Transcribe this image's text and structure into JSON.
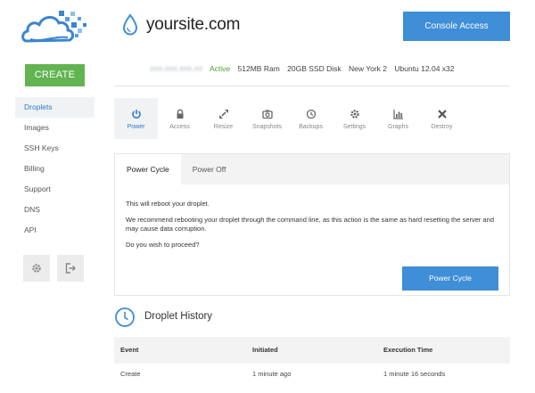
{
  "sidebar": {
    "create_label": "CREATE",
    "items": [
      {
        "label": "Droplets",
        "active": true
      },
      {
        "label": "Images"
      },
      {
        "label": "SSH Keys"
      },
      {
        "label": "Billing"
      },
      {
        "label": "Support"
      },
      {
        "label": "DNS"
      },
      {
        "label": "API"
      }
    ],
    "bottom_icons": [
      "gear-icon",
      "logout-icon"
    ]
  },
  "header": {
    "title": "yoursite.com",
    "console_button": "Console Access"
  },
  "info": {
    "ip_blurred": "###.###.###.##",
    "status": "Active",
    "ram": "512MB Ram",
    "disk": "20GB SSD Disk",
    "region": "New York 2",
    "os": "Ubuntu 12.04 x32"
  },
  "actions": [
    {
      "label": "Power",
      "icon": "power-icon",
      "active": true
    },
    {
      "label": "Access",
      "icon": "lock-icon"
    },
    {
      "label": "Resize",
      "icon": "resize-icon"
    },
    {
      "label": "Snapshots",
      "icon": "camera-icon"
    },
    {
      "label": "Backups",
      "icon": "history-icon"
    },
    {
      "label": "Settings",
      "icon": "gear-icon"
    },
    {
      "label": "Graphs",
      "icon": "bar-chart-icon"
    },
    {
      "label": "Destroy",
      "icon": "x-icon"
    }
  ],
  "power": {
    "tabs": [
      {
        "label": "Power Cycle",
        "active": true
      },
      {
        "label": "Power Off"
      }
    ],
    "line1": "This will reboot your droplet.",
    "line2": "We recommend rebooting your droplet through the command line, as this action is the same as hard resetting the server and may cause data corruption.",
    "line3": "Do you wish to proceed?",
    "button": "Power Cycle"
  },
  "history": {
    "title": "Droplet History",
    "columns": [
      "Event",
      "Initiated",
      "Execution Time"
    ],
    "rows": [
      {
        "event": "Create",
        "initiated": "1 minute ago",
        "execution_time": "1 minute 16 seconds"
      }
    ]
  },
  "colors": {
    "accent": "#3f8ed8",
    "create": "#61b450",
    "active_status": "#4d9c3a"
  }
}
